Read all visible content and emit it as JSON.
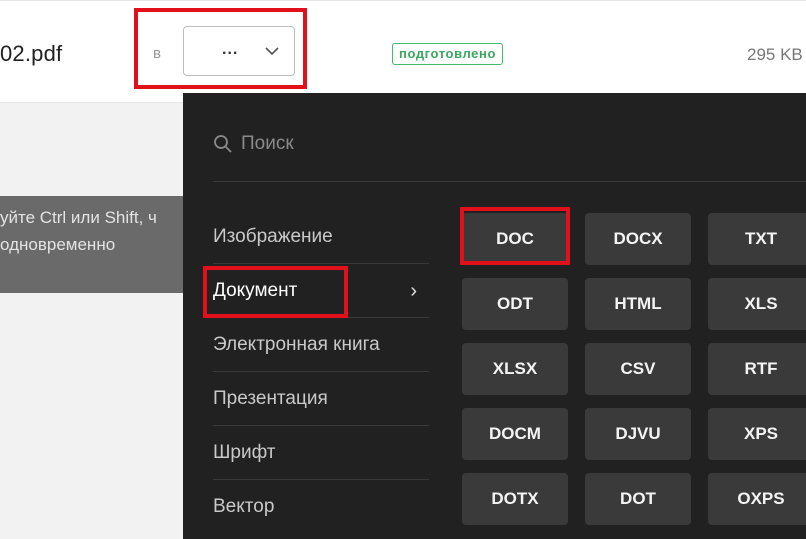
{
  "file_row": {
    "file_name": "02.pdf",
    "target_prefix": "в",
    "format_select_value": "...",
    "status": "подготовлено",
    "size": "295 KB"
  },
  "tip": {
    "line1": "уйте Ctrl или Shift, ч",
    "line2": "одновременно"
  },
  "dropdown": {
    "search_placeholder": "Поиск",
    "categories": [
      {
        "label": "Изображение"
      },
      {
        "label": "Документ",
        "active": true
      },
      {
        "label": "Электронная книга"
      },
      {
        "label": "Презентация"
      },
      {
        "label": "Шрифт"
      },
      {
        "label": "Вектор"
      }
    ],
    "formats": [
      [
        "DOC",
        "DOCX",
        "TXT"
      ],
      [
        "ODT",
        "HTML",
        "XLS"
      ],
      [
        "XLSX",
        "CSV",
        "RTF"
      ],
      [
        "DOCM",
        "DJVU",
        "XPS"
      ],
      [
        "DOTX",
        "DOT",
        "OXPS"
      ]
    ]
  },
  "colors": {
    "highlight": "#e2101a",
    "panel_bg": "#212121",
    "button_bg": "#3a3a3a",
    "status_green": "#3aa85e"
  }
}
